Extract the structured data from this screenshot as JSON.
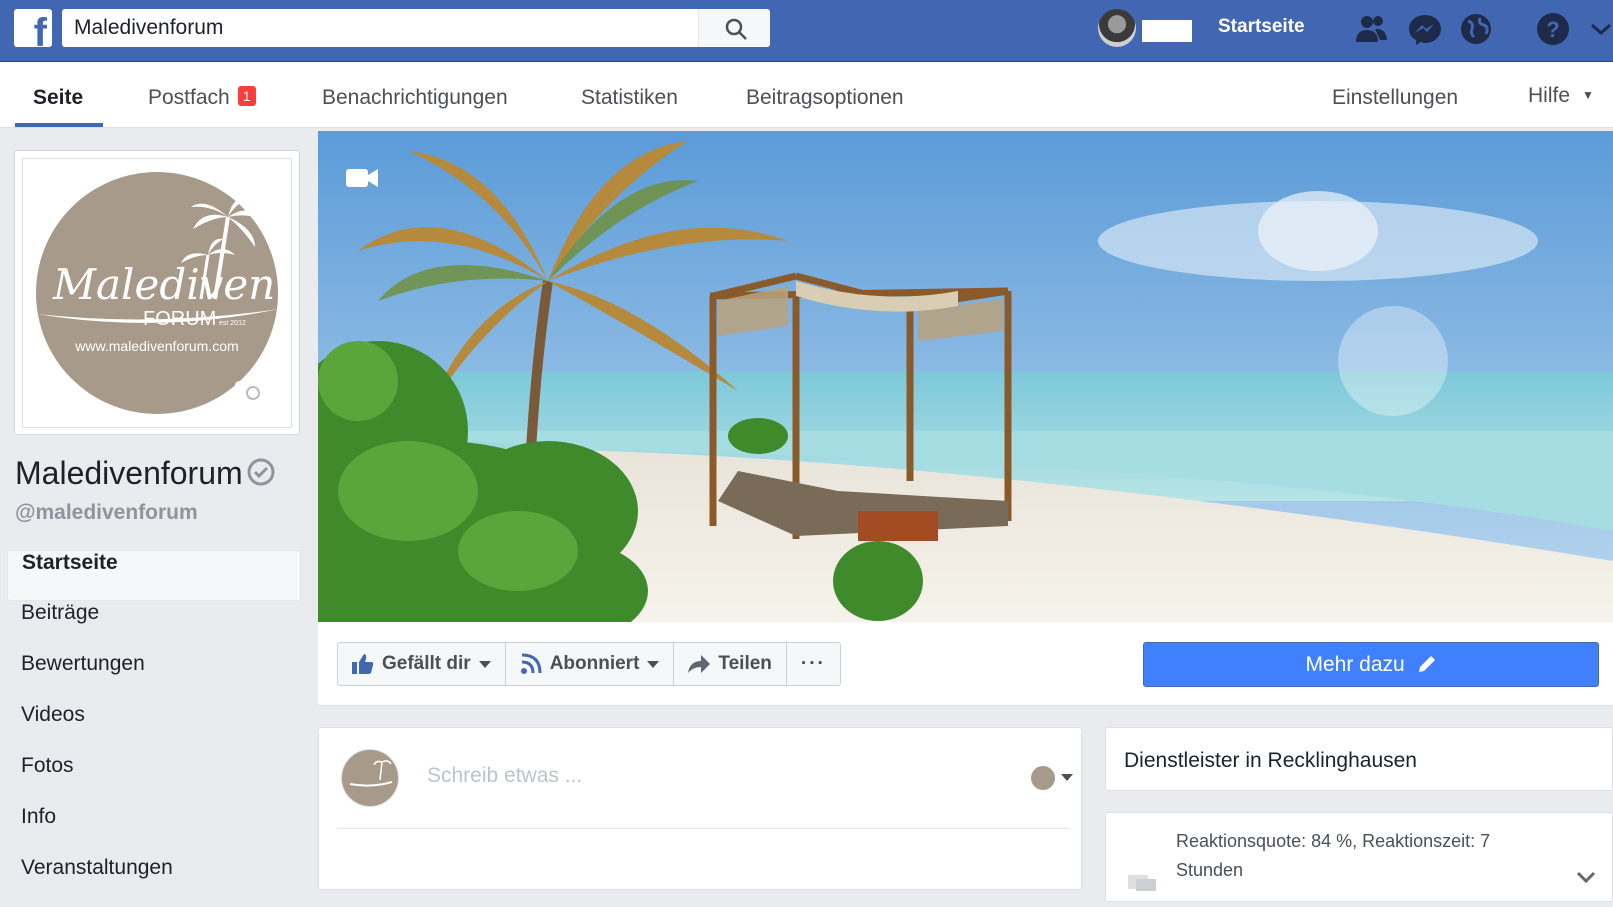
{
  "topbar": {
    "logo_letter": "f",
    "search_value": "Maledivenforum",
    "search_icon": "search-icon",
    "home_label": "Startseite",
    "icons": [
      "friends-icon",
      "messenger-icon",
      "globe-icon",
      "help-icon",
      "chevron-down-icon"
    ],
    "brand_color": "#4267b2"
  },
  "tabs": {
    "page": "Seite",
    "inbox": "Postfach",
    "inbox_badge": "1",
    "notifications": "Benachrichtigungen",
    "insights": "Statistiken",
    "publishing": "Beitragsoptionen",
    "settings": "Einstellungen",
    "help": "Hilfe"
  },
  "profile": {
    "logo_script": "Malediven",
    "logo_word": "FORUM",
    "logo_est": "est 2012",
    "logo_url": "www.maledivenforum.com",
    "name": "Maledivenforum",
    "handle": "@maledivenforum"
  },
  "leftnav": {
    "items": [
      {
        "label": "Startseite",
        "active": true
      },
      {
        "label": "Beiträge"
      },
      {
        "label": "Bewertungen"
      },
      {
        "label": "Videos"
      },
      {
        "label": "Fotos"
      },
      {
        "label": "Info"
      },
      {
        "label": "Veranstaltungen"
      }
    ]
  },
  "actions": {
    "like": "Gefällt dir",
    "follow": "Abonniert",
    "share": "Teilen",
    "more": "···",
    "cta": "Mehr dazu"
  },
  "composer": {
    "placeholder": "Schreib etwas ..."
  },
  "sidebar": {
    "category": "Dienstleister in Recklinghausen",
    "response_line1": "Reaktionsquote: 84 %, Reaktionszeit: 7",
    "response_line2": "Stunden"
  },
  "colors": {
    "cta": "#4080ff",
    "badge": "#fa3e3e",
    "logo_taupe": "#a89a8a"
  }
}
